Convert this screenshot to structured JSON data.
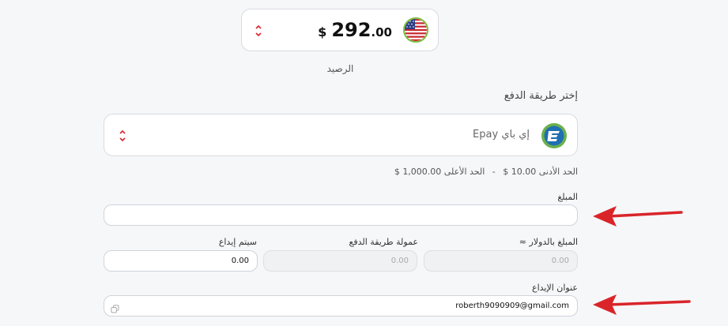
{
  "balance": {
    "currency_symbol": "$",
    "amount_int": "292",
    "amount_dec": ".00",
    "label": "الرصيد",
    "flag_icon": "us-flag-icon"
  },
  "payment_method": {
    "section_title": "إختر طريقة الدفع",
    "selected_name": "إي باي Epay",
    "logo_icon": "epay-logo-icon"
  },
  "limits": {
    "min_text": "الحد الأدنى 10.00 $",
    "separator": "-",
    "max_text": "الحد الأعلى 1,000.00 $"
  },
  "form": {
    "amount_label": "المبلغ",
    "amount_value": "",
    "usd_amount_label": "المبلغ بالدولار ≈",
    "usd_amount_value": "0.00",
    "fee_label": "عمولة طريقة الدفع",
    "fee_value": "0.00",
    "deposit_label": "سيتم إيداع",
    "deposit_value": "0.00",
    "address_label": "عنوان الإيداع",
    "address_value": "roberth9090909@gmail.com"
  },
  "colors": {
    "accent_red": "#d9252a",
    "epay_green": "#6ab04c",
    "epay_blue": "#1f6fb2"
  }
}
